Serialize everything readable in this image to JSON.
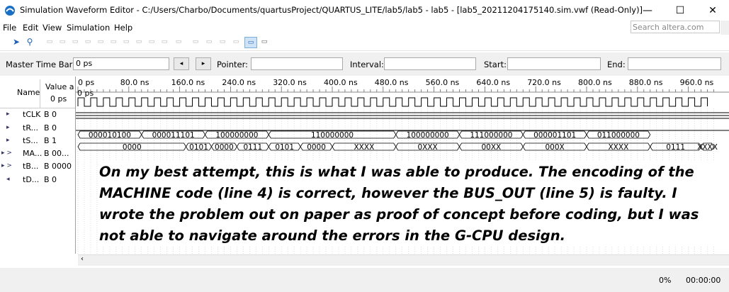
{
  "window": {
    "title": "Simulation Waveform Editor - C:/Users/Charbo/Documents/quartusProject/QUARTUS_LITE/lab5/lab5 - lab5 - [lab5_20211204175140.sim.vwf (Read-Only)]",
    "minimize": "—",
    "maximize": "☐",
    "close": "✕"
  },
  "menu": [
    "File",
    "Edit",
    "View",
    "Simulation",
    "Help"
  ],
  "search": {
    "placeholder": "Search altera.com"
  },
  "timebar": {
    "master_label": "Master Time Bar:",
    "master_value": "0 ps",
    "prev": "◂",
    "next": "▸",
    "pointer_label": "Pointer:",
    "pointer_value": "",
    "interval_label": "Interval:",
    "interval_value": "",
    "start_label": "Start:",
    "start_value": "",
    "end_label": "End:",
    "end_value": ""
  },
  "header": {
    "name_label": "Name",
    "value_label": "Value a",
    "value_sub": "0 ps",
    "cursor_label": "0 ps",
    "time_ticks": [
      "0 ps",
      "80.0 ns",
      "160.0 ns",
      "240.0 ns",
      "320.0 ns",
      "400.0 ns",
      "480.0 ns",
      "560.0 ns",
      "640.0 ns",
      "720.0 ns",
      "800.0 ns",
      "880.0 ns",
      "960.0 ns"
    ],
    "time_end_ns": 1000
  },
  "signals": [
    {
      "name": "tCLK",
      "value": "B 0",
      "icon": "input-pin-icon"
    },
    {
      "name": "tR...",
      "value": "B 0",
      "icon": "input-pin-icon"
    },
    {
      "name": "tS...",
      "value": "B 1",
      "icon": "input-pin-icon"
    },
    {
      "name": "MA...",
      "value": "B 00...",
      "icon": "bus-icon"
    },
    {
      "name": "tB...",
      "value": "B 0000",
      "icon": "bus-icon"
    },
    {
      "name": "tD...",
      "value": "B 0",
      "icon": "output-pin-icon"
    }
  ],
  "waveforms": {
    "clock_period_ns": 20,
    "machine_bus": [
      {
        "start": 0,
        "end": 100,
        "label": "000010100"
      },
      {
        "start": 100,
        "end": 200,
        "label": "000011101"
      },
      {
        "start": 200,
        "end": 300,
        "label": "100000000"
      },
      {
        "start": 300,
        "end": 500,
        "label": "110000000"
      },
      {
        "start": 500,
        "end": 600,
        "label": "100000000"
      },
      {
        "start": 600,
        "end": 700,
        "label": "111000000"
      },
      {
        "start": 700,
        "end": 800,
        "label": "000001101"
      },
      {
        "start": 800,
        "end": 900,
        "label": "011000000"
      }
    ],
    "bus_out": [
      {
        "start": 0,
        "end": 170,
        "label": "0000"
      },
      {
        "start": 170,
        "end": 210,
        "label": "0101"
      },
      {
        "start": 210,
        "end": 250,
        "label": "0000"
      },
      {
        "start": 250,
        "end": 300,
        "label": "0111"
      },
      {
        "start": 300,
        "end": 350,
        "label": "0101"
      },
      {
        "start": 350,
        "end": 400,
        "label": "0000"
      },
      {
        "start": 400,
        "end": 500,
        "label": "XXXX"
      },
      {
        "start": 500,
        "end": 600,
        "label": "0XXX"
      },
      {
        "start": 600,
        "end": 700,
        "label": "00XX"
      },
      {
        "start": 700,
        "end": 800,
        "label": "000X"
      },
      {
        "start": 800,
        "end": 900,
        "label": "XXXX"
      },
      {
        "start": 900,
        "end": 980,
        "label": "0111"
      },
      {
        "start": 980,
        "end": 1000,
        "label": "XXXX"
      }
    ]
  },
  "annotation": "On my best attempt, this is what I was able to produce. The encoding of the MACHINE code (line 4) is correct, however the BUS_OUT (line 5) is faulty. I wrote the problem out on paper as proof of concept before coding, but I was not able to navigate around the errors in the G-CPU design.",
  "status": {
    "progress": "0%",
    "elapsed": "00:00:00"
  }
}
